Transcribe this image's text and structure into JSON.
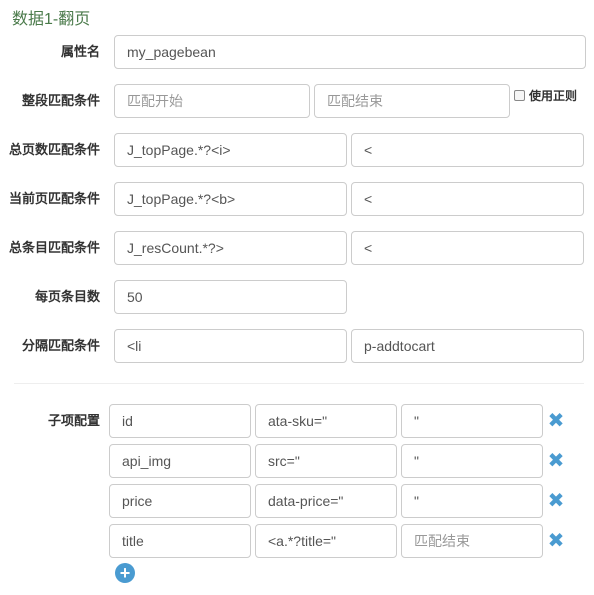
{
  "title": "数据1-翻页",
  "fields": {
    "attr_name": {
      "label": "属性名",
      "value": "my_pagebean"
    },
    "full_match": {
      "label": "整段匹配条件",
      "start_placeholder": "匹配开始",
      "end_placeholder": "匹配结束",
      "regex_label": "使用正则"
    },
    "total_pages": {
      "label": "总页数匹配条件",
      "start": "J_topPage.*?<i>",
      "end": "<"
    },
    "current_page": {
      "label": "当前页匹配条件",
      "start": "J_topPage.*?<b>",
      "end": "<"
    },
    "total_items": {
      "label": "总条目匹配条件",
      "start": "J_resCount.*?>",
      "end": "<"
    },
    "per_page": {
      "label": "每页条目数",
      "value": "50"
    },
    "separator": {
      "label": "分隔匹配条件",
      "start": "<li",
      "end": "p-addtocart"
    }
  },
  "children": {
    "label": "子项配置",
    "end_placeholder": "匹配结束",
    "items": [
      {
        "name": "id",
        "start": "ata-sku=\"",
        "end": "\""
      },
      {
        "name": "api_img",
        "start": "src=\"",
        "end": "\""
      },
      {
        "name": "price",
        "start": "data-price=\"",
        "end": "\""
      },
      {
        "name": "title",
        "start": "<a.*?title=\"",
        "end": ""
      }
    ]
  },
  "icons": {
    "remove": "close-icon",
    "add": "plus-circle-icon"
  },
  "colors": {
    "accent": "#4a9bd1",
    "title": "#4a7a4a"
  }
}
